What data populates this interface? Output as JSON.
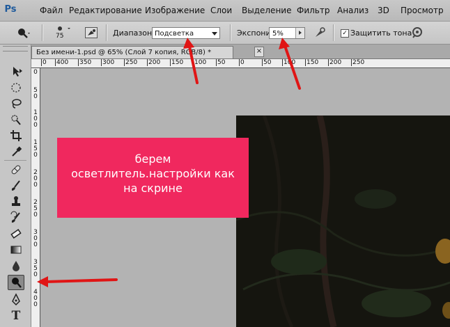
{
  "app": {
    "logo": "Ps"
  },
  "menu": [
    "Файл",
    "Редактирование",
    "Изображение",
    "Слои",
    "Выделение",
    "Фильтр",
    "Анализ",
    "3D",
    "Просмотр"
  ],
  "options": {
    "brush_size": "75",
    "range_label": "Диапазон:",
    "range_value": "Подсветка",
    "exposure_label": "Экспонир.:",
    "exposure_value": "5%",
    "protect_label": "Защитить тона",
    "protect_checked": "✓"
  },
  "document": {
    "tab_title": "Без имени-1.psd @ 65% (Слой 7 копия, RGB/8) *",
    "close": "×"
  },
  "ruler_h": [
    "0",
    "400",
    "350",
    "300",
    "250",
    "200",
    "150",
    "100",
    "50",
    "0",
    "50",
    "100",
    "150",
    "200",
    "250"
  ],
  "ruler_v": [
    "0",
    "5",
    "0",
    "1",
    "0",
    "0",
    "1",
    "5",
    "0",
    "2",
    "0",
    "0",
    "2",
    "5",
    "0",
    "3",
    "0",
    "0",
    "3",
    "5",
    "0",
    "4",
    "0",
    "0"
  ],
  "callout": {
    "line1": "берем",
    "line2": "осветлитель.настройки как",
    "line3": "на скрине"
  },
  "icons": [
    "dodge-tool-icon",
    "brush-preset-icon",
    "airbrush-icon",
    "move-tool-icon",
    "lasso-icon",
    "crop-icon",
    "eyedropper-icon",
    "healing-brush-icon",
    "brush-icon",
    "clone-stamp-icon",
    "history-brush-icon",
    "eraser-icon",
    "gradient-icon",
    "blur-icon",
    "dodge-icon",
    "pen-icon",
    "type-icon"
  ],
  "colors": {
    "callout_bg": "#f0285e",
    "arrow": "#e01515"
  }
}
